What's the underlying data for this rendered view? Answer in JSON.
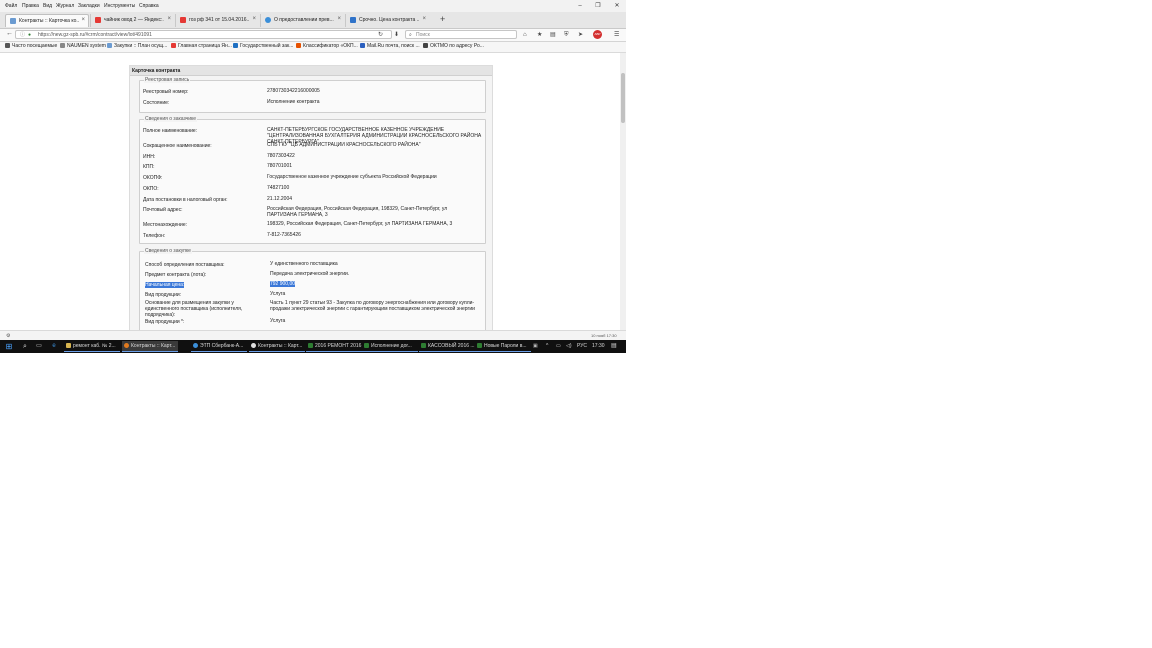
{
  "menu": [
    "Файл",
    "Правка",
    "Вид",
    "Журнал",
    "Закладки",
    "Инструменты",
    "Справка"
  ],
  "window_controls": {
    "minimize": "–",
    "restore": "❐",
    "close": "✕"
  },
  "tabs": [
    {
      "title": "Контракты :: Карточка ко...",
      "close": "×",
      "color": "#6b9bd1"
    },
    {
      "title": "чайник овод 2 — Яндекс:...",
      "close": "×",
      "color": "#e53935"
    },
    {
      "title": "гоз рф 341 от 15.04.2016...",
      "close": "×",
      "color": "#e53935"
    },
    {
      "title": "О предоставлении прев...",
      "close": "×",
      "color": "#3b8fd9"
    },
    {
      "title": "Срочно. Цена контракта ...",
      "close": "×",
      "color": "#2f73c9"
    }
  ],
  "new_tab": "+",
  "nav": {
    "back": "←",
    "info_icon": "ⓘ",
    "url": "https://new.gz-spb.ru/#crm/contract/view/lot/491091",
    "reload": "↻",
    "search_placeholder": "Поиск",
    "icons": [
      "⬇",
      "⌂",
      "★",
      "▤",
      "⛨",
      "➤"
    ],
    "adblock": "ABP",
    "menu": "☰"
  },
  "bookmarks": [
    {
      "label": "Часто посещаемые",
      "color": "#555"
    },
    {
      "label": "NAUMEN system",
      "color": "#888"
    },
    {
      "label": "Закупки :: План осущ...",
      "color": "#6b9bd1"
    },
    {
      "label": "Главная страница Ян...",
      "color": "#e53935"
    },
    {
      "label": "Государственный зак...",
      "color": "#1e6fc2"
    },
    {
      "label": "Классификатор «ОКП...",
      "color": "#e65100"
    },
    {
      "label": "Mail.Ru почта, поиск ...",
      "color": "#2a5fbf"
    },
    {
      "label": "ОКТМО по адресу Ро...",
      "color": "#444"
    }
  ],
  "card": {
    "title": "Карточка контракта",
    "registry": {
      "legend": "Реестровая запись",
      "rows": [
        {
          "label": "Реестровый номер:",
          "value": "2780730342216000005"
        },
        {
          "label": "Состояние:",
          "value": "Исполнение контракта"
        }
      ]
    },
    "customer": {
      "legend": "Сведения о заказчике",
      "rows": [
        {
          "label": "Полное наименование:",
          "value": "САНКТ-ПЕТЕРБУРГСКОЕ ГОСУДАРСТВЕННОЕ КАЗЕННОЕ УЧРЕЖДЕНИЕ \"ЦЕНТРАЛИЗОВАННАЯ БУХГАЛТЕРИЯ АДМИНИСТРАЦИИ КРАСНОСЕЛЬСКОГО РАЙОНА САНКТ-ПЕТЕРБУРГА\""
        },
        {
          "label": "Сокращенное наименование:",
          "value": "СПБ ГКУ \"ЦБ АДМИНИСТРАЦИИ КРАСНОСЕЛЬСКОГО РАЙОНА\""
        },
        {
          "label": "ИНН:",
          "value": "7807303422"
        },
        {
          "label": "КПП:",
          "value": "780701001"
        },
        {
          "label": "ОКОПФ:",
          "value": "Государственное казенное учреждение субъекта Российской Федерации"
        },
        {
          "label": "ОКПО:",
          "value": "74827100"
        },
        {
          "label": "Дата постановки в налоговый орган:",
          "value": "21.12.2004"
        },
        {
          "label": "Почтовый адрес:",
          "value": "Российская Федерация, Российская Федерация, 198329, Санкт-Петербург, ул ПАРТИЗАНА ГЕРМАНА, 3"
        },
        {
          "label": "Местонахождение:",
          "value": "198329, Российская Федерация, Санкт-Петербург, ул ПАРТИЗАНА ГЕРМАНА, 3"
        },
        {
          "label": "Телефон:",
          "value": "7-812-7365426"
        }
      ]
    },
    "procurement": {
      "legend": "Сведения о закупке",
      "rows": [
        {
          "label": "Способ определения поставщика:",
          "value": "У единственного поставщика"
        },
        {
          "label": "Предмет контракта (лота):",
          "value": "Передача электрической энергии."
        },
        {
          "label": "Начальная цена:",
          "value": "792 900,00"
        },
        {
          "label": "Вид продукции:",
          "value": "Услуга"
        },
        {
          "label": "Основание для размещения закупки у единственного поставщика (исполнителя, подрядчика):",
          "value": "Часть 1 пункт 29 статьи 93 - Закупка по договору энергоснабжения или договору купли-продажи электрической энергии с гарантирующим поставщиком электрической энергии"
        },
        {
          "label": "Вид продукции *:",
          "value": "Услуга"
        }
      ]
    }
  },
  "status": {
    "left": "⚙",
    "right": "10 нояб 17:30"
  },
  "taskbar": {
    "apps": [
      {
        "title": "ремонт каб. № 2...",
        "color": "#d9b650"
      },
      {
        "title": "Контракты :: Карт...",
        "color": "#e07a1f"
      },
      {
        "title": "ЭТП Сбербанк-А...",
        "color": "#3b8fd9"
      },
      {
        "title": "Контракты :: Карт...",
        "color": "#e0e0e0"
      },
      {
        "title": "2016 РЕМОНТ 2016",
        "color": "#2e7d32"
      },
      {
        "title": "Исполнение дог...",
        "color": "#2e7d32"
      },
      {
        "title": "КАССОВЫЙ 2016 ...",
        "color": "#2e7d32"
      },
      {
        "title": "Новые Пароли в...",
        "color": "#2e7d32"
      }
    ],
    "lang": "РУС",
    "time": "17:30"
  }
}
